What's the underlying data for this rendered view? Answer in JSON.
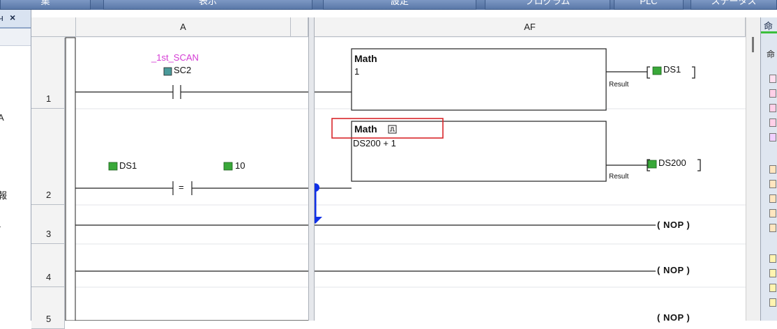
{
  "menu": [
    "集",
    "表示",
    "設定",
    "プログラム",
    "PLC",
    "ステータス"
  ],
  "left_panel": {
    "title": "ч",
    "close_label": "×",
    "texts": [
      "A",
      "報",
      "-"
    ]
  },
  "columns": [
    "A",
    "AF"
  ],
  "rows": [
    "1",
    "2",
    "3",
    "4",
    "5"
  ],
  "right_panel": {
    "title": "命",
    "tab": "命"
  },
  "rungs": {
    "r1": {
      "nickname": "_1st_SCAN",
      "contact_address": "SC2",
      "math_title": "Math",
      "math_formula": "1",
      "result_label": "Result",
      "output": "DS1"
    },
    "r2": {
      "compare_left": "DS1",
      "compare_op": "=",
      "compare_right": "10",
      "math_title": "Math",
      "math_formula": "DS200 + 1",
      "result_label": "Result",
      "output": "DS200"
    },
    "r3": {
      "coil": "( NOP )"
    },
    "r4": {
      "coil": "( NOP )"
    },
    "r5": {
      "coil": "( NOP )"
    }
  },
  "colors": {
    "nickname": "#d43bd4",
    "highlight_box": "#d9262b",
    "flow_arrow": "#1030e6",
    "data_icon": "#39a839"
  }
}
